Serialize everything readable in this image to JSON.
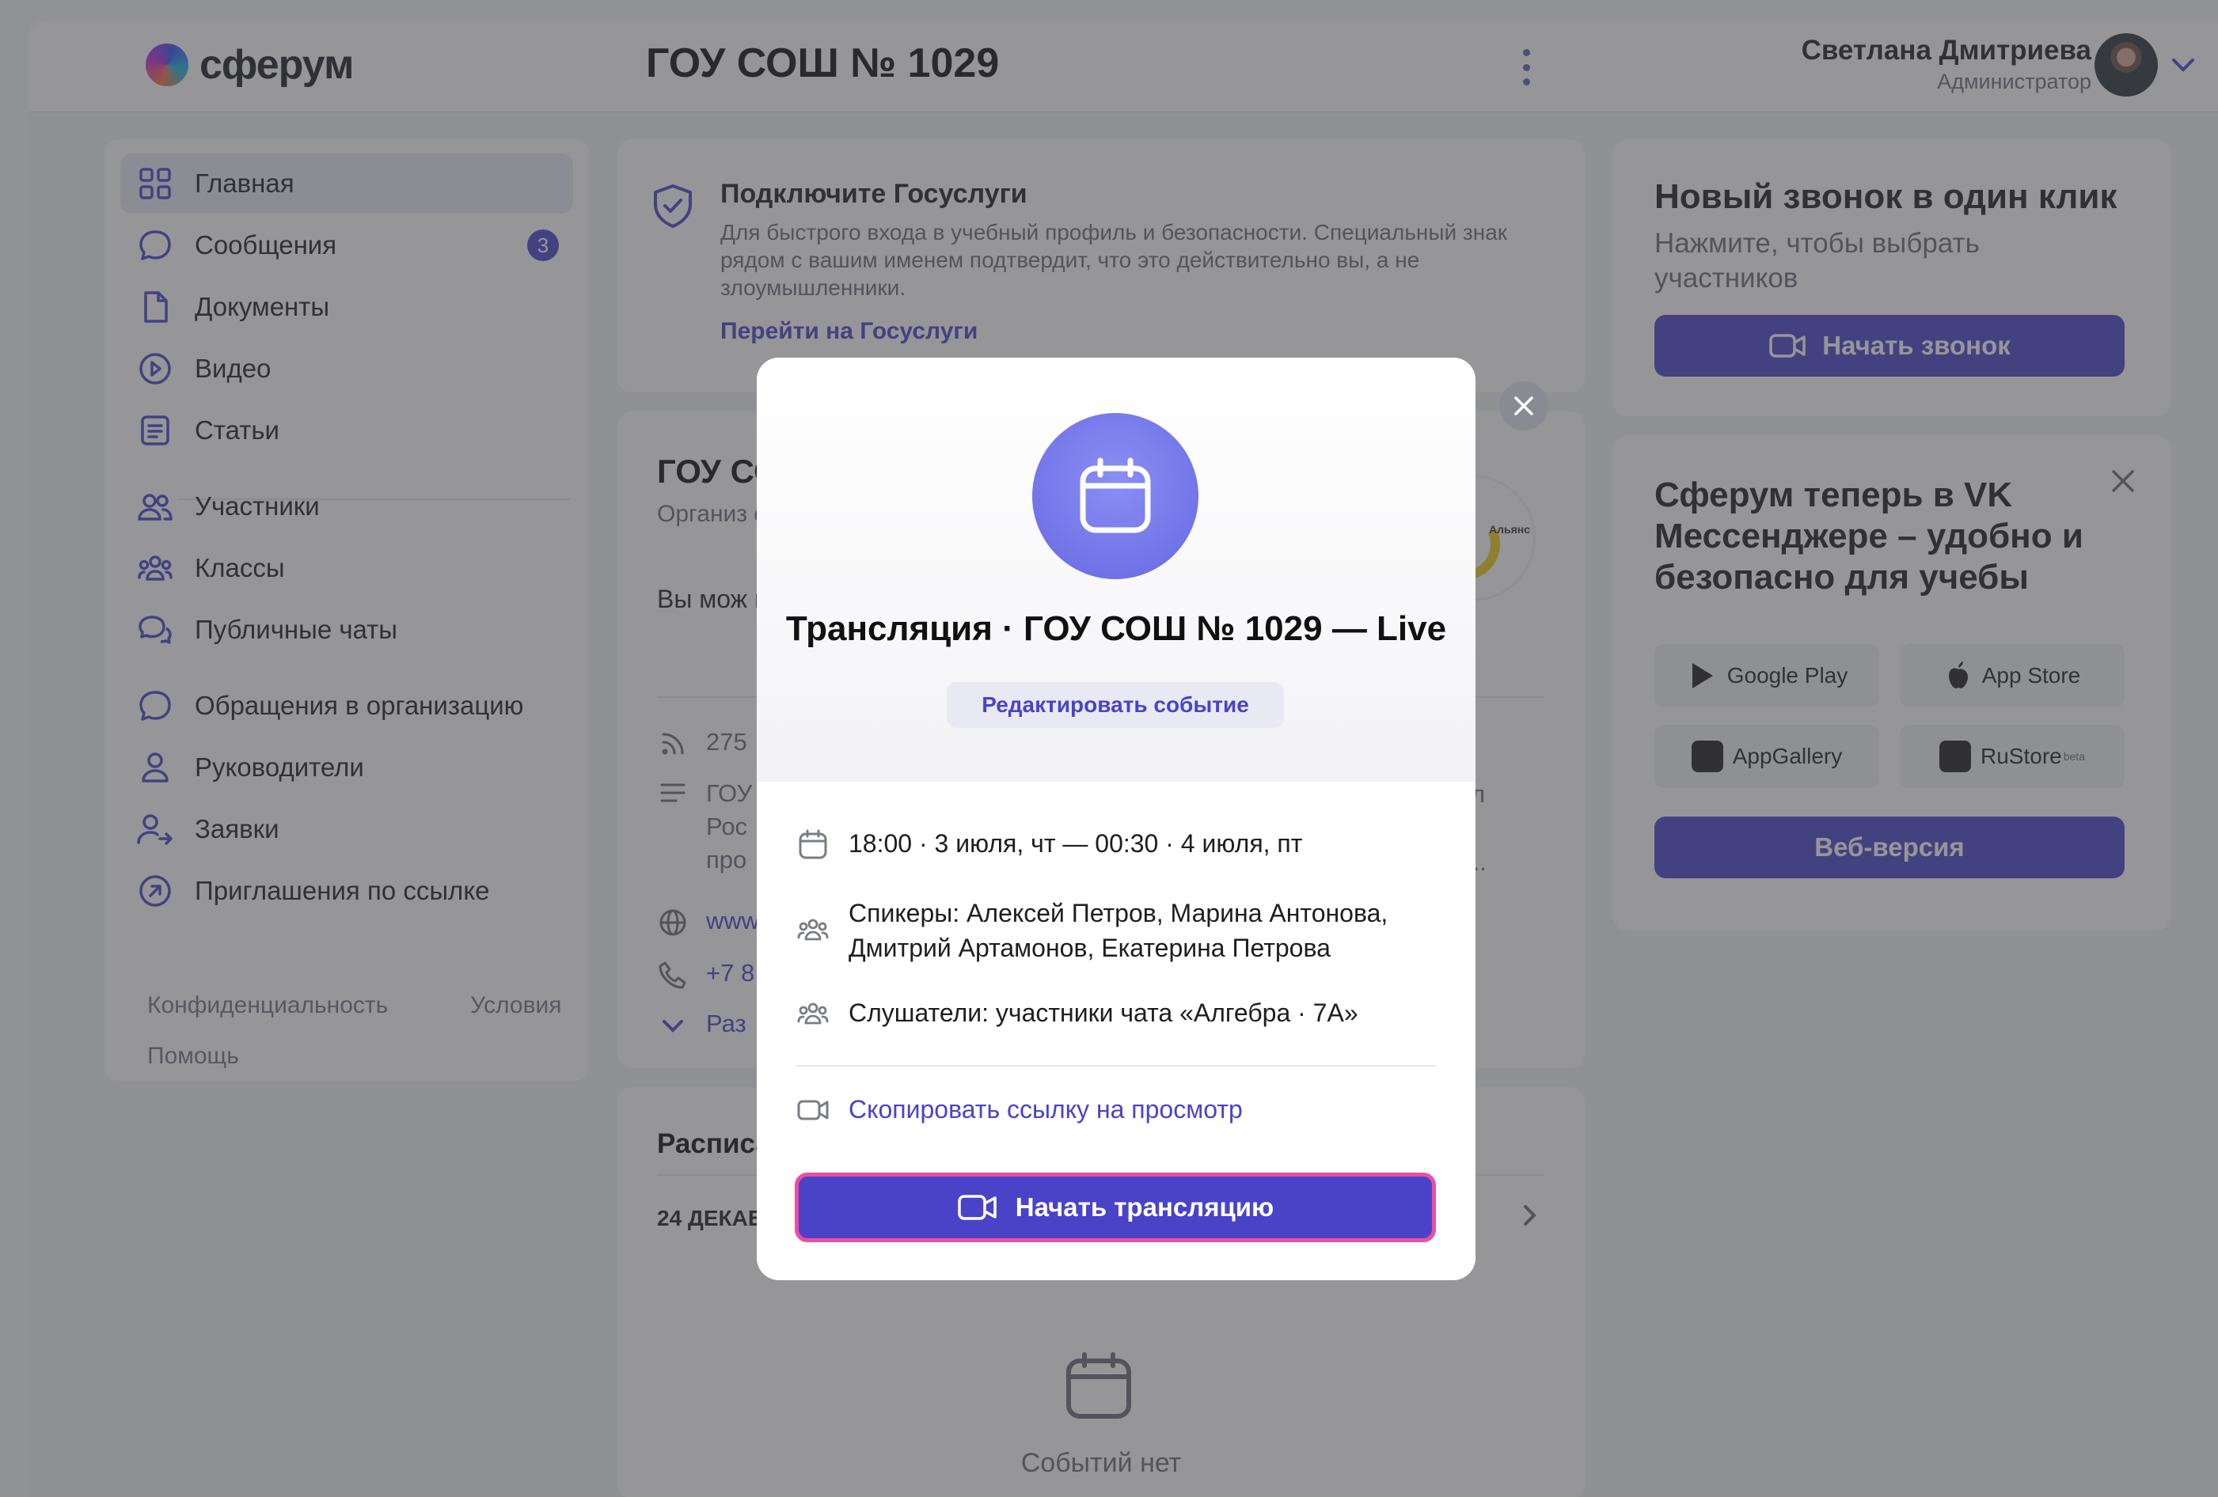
{
  "header": {
    "logo_text": "сферум",
    "org_title": "ГОУ СОШ № 1029",
    "user_name": "Светлана Дмитриева",
    "user_role": "Администратор"
  },
  "sidebar": {
    "items": [
      {
        "label": "Главная",
        "icon": "grid-icon"
      },
      {
        "label": "Сообщения",
        "icon": "message-bubble-icon",
        "badge": "3"
      },
      {
        "label": "Документы",
        "icon": "document-icon"
      },
      {
        "label": "Видео",
        "icon": "play-circle-icon"
      },
      {
        "label": "Статьи",
        "icon": "article-icon"
      },
      {
        "label": "Участники",
        "icon": "people-icon"
      },
      {
        "label": "Классы",
        "icon": "group-icon"
      },
      {
        "label": "Публичные чаты",
        "icon": "chats-icon"
      },
      {
        "label": "Обращения в организацию",
        "icon": "message-bubble-icon"
      },
      {
        "label": "Руководители",
        "icon": "person-icon"
      },
      {
        "label": "Заявки",
        "icon": "person-arrow-icon"
      },
      {
        "label": "Приглашения по ссылке",
        "icon": "link-arrow-icon"
      }
    ],
    "footer": {
      "privacy": "Конфиденциальность",
      "terms": "Условия",
      "help": "Помощь"
    }
  },
  "gosuslugi": {
    "title": "Подключите Госуслуги",
    "description": "Для быстрого входа в учебный профиль и безопасности. Специальный знак рядом с вашим именем подтвердит, что это действительно вы, а не злоумышленники.",
    "link": "Перейти на Госуслуги"
  },
  "org_info": {
    "title": "ГОУ СО",
    "subtitle": "Организ образова",
    "text": "Вы мож перепод",
    "rss_count": "275",
    "desc_lines": [
      "ГОУ",
      "Рос",
      "про"
    ],
    "website": "www",
    "phone": "+7 8",
    "expand": "Раз",
    "desc_right_a": "л",
    "desc_right_b": "...",
    "logo_caption": "Альянс"
  },
  "schedule": {
    "title": "Расписа",
    "date": "24 ДЕКАБ",
    "empty": "Событий нет"
  },
  "call_card": {
    "title": "Новый звонок в один клик",
    "subtitle": "Нажмите, чтобы выбрать участников",
    "button": "Начать звонок"
  },
  "promo": {
    "title": "Сферум теперь в VK Мессенджере – удобно и безопасно для учебы",
    "stores": [
      {
        "label": "Google Play",
        "icon": "google-play-icon"
      },
      {
        "label": "App Store",
        "icon": "apple-icon"
      },
      {
        "label": "AppGallery",
        "icon": "huawei-icon"
      },
      {
        "label": "RuStore",
        "icon": "rustore-icon",
        "badge": "beta"
      }
    ],
    "web_button": "Веб-версия"
  },
  "modal": {
    "title": "Трансляция · ГОУ СОШ № 1029 — Live",
    "edit_button": "Редактировать событие",
    "datetime": "18:00 · 3 июля, чт — 00:30 · 4 июля, пт",
    "speakers": "Спикеры: Алексей Петров, Марина Антонова, Дмитрий Артамонов, Екатерина Петрова",
    "listeners": "Слушатели: участники чата «Алгебра · 7А»",
    "copy_link": "Скопировать ссылку на просмотр",
    "start_button": "Начать трансляцию"
  },
  "colors": {
    "accent": "#4a43c8",
    "highlight_border": "#ee4d9e",
    "overlay": "#404046"
  }
}
